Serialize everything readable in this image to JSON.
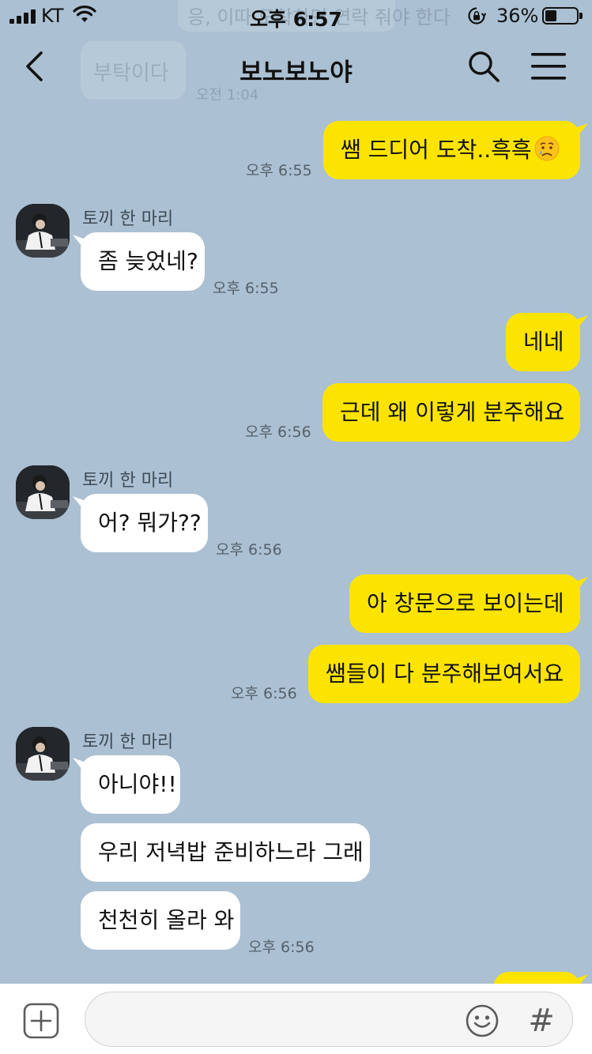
{
  "status_bar": {
    "carrier": "KT",
    "time": "오후 6:57",
    "battery_percent": "36%",
    "battery_level": 0.36
  },
  "background_remnants": {
    "banner_text": "응, 이따 도착하면 연락 줘야 한다",
    "bubble_text": "부탁이다",
    "time": "오전 1:04"
  },
  "header": {
    "title": "보노보노야",
    "back_icon": "chevron-left-icon",
    "search_icon": "search-icon",
    "menu_icon": "hamburger-menu-icon"
  },
  "contact": {
    "name": "토끼 한 마리"
  },
  "messages": [
    {
      "from": "me",
      "text": "쌤 드디어 도착..흑흑",
      "emoji": "crying-face-emoji",
      "time": "오후 6:55"
    },
    {
      "from": "other",
      "text": "좀 늦었네?",
      "time": "오후 6:55"
    },
    {
      "from": "me",
      "text": "네네",
      "time": ""
    },
    {
      "from": "me",
      "text": "근데 왜 이렇게 분주해요",
      "time": "오후 6:56"
    },
    {
      "from": "other",
      "text": "어? 뭐가??",
      "time": "오후 6:56"
    },
    {
      "from": "me",
      "text": "아 창문으로 보이는데",
      "time": ""
    },
    {
      "from": "me",
      "text": "쌤들이 다 분주해보여서요",
      "time": "오후 6:56"
    },
    {
      "from": "other",
      "text": "아니야!!",
      "time": ""
    },
    {
      "from": "other",
      "text": "우리 저녁밥 준비하느라 그래",
      "time": ""
    },
    {
      "from": "other",
      "text": "천천히 올라 와",
      "time": "오후 6:56"
    }
  ],
  "input_bar": {
    "plus_icon": "plus-square-icon",
    "placeholder": "",
    "emoji_icon": "smiley-icon",
    "hash_label": "#"
  },
  "colors": {
    "chat_background": "#abc0d2",
    "my_bubble": "#fde400",
    "other_bubble": "#ffffff"
  }
}
